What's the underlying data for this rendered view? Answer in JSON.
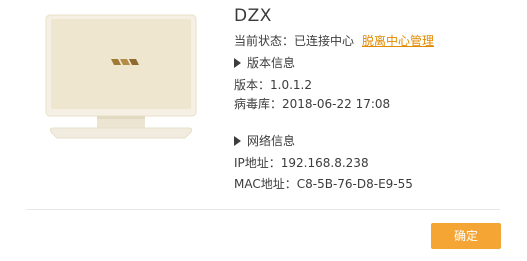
{
  "device": {
    "name": "DZX",
    "status_label": "当前状态：",
    "status_value": "已连接中心",
    "status_link": "脱离中心管理"
  },
  "version_section": {
    "title": "版本信息",
    "version_label": "版本：",
    "version_value": "1.0.1.2",
    "virus_label": "病毒库：",
    "virus_value": "2018-06-22 17:08"
  },
  "network_section": {
    "title": "网络信息",
    "ip_label": "IP地址：",
    "ip_value": "192.168.8.238",
    "mac_label": "MAC地址：",
    "mac_value": "C8-5B-76-D8-E9-55"
  },
  "footer": {
    "confirm_label": "确定"
  },
  "colors": {
    "accent": "#f4a534",
    "link": "#e08a00",
    "monitor_screen": "#efe6cf",
    "monitor_frame": "#f7f3e8"
  },
  "icons": {
    "monitor": "monitor-illustration-icon",
    "expand": "triangle-right-icon"
  }
}
